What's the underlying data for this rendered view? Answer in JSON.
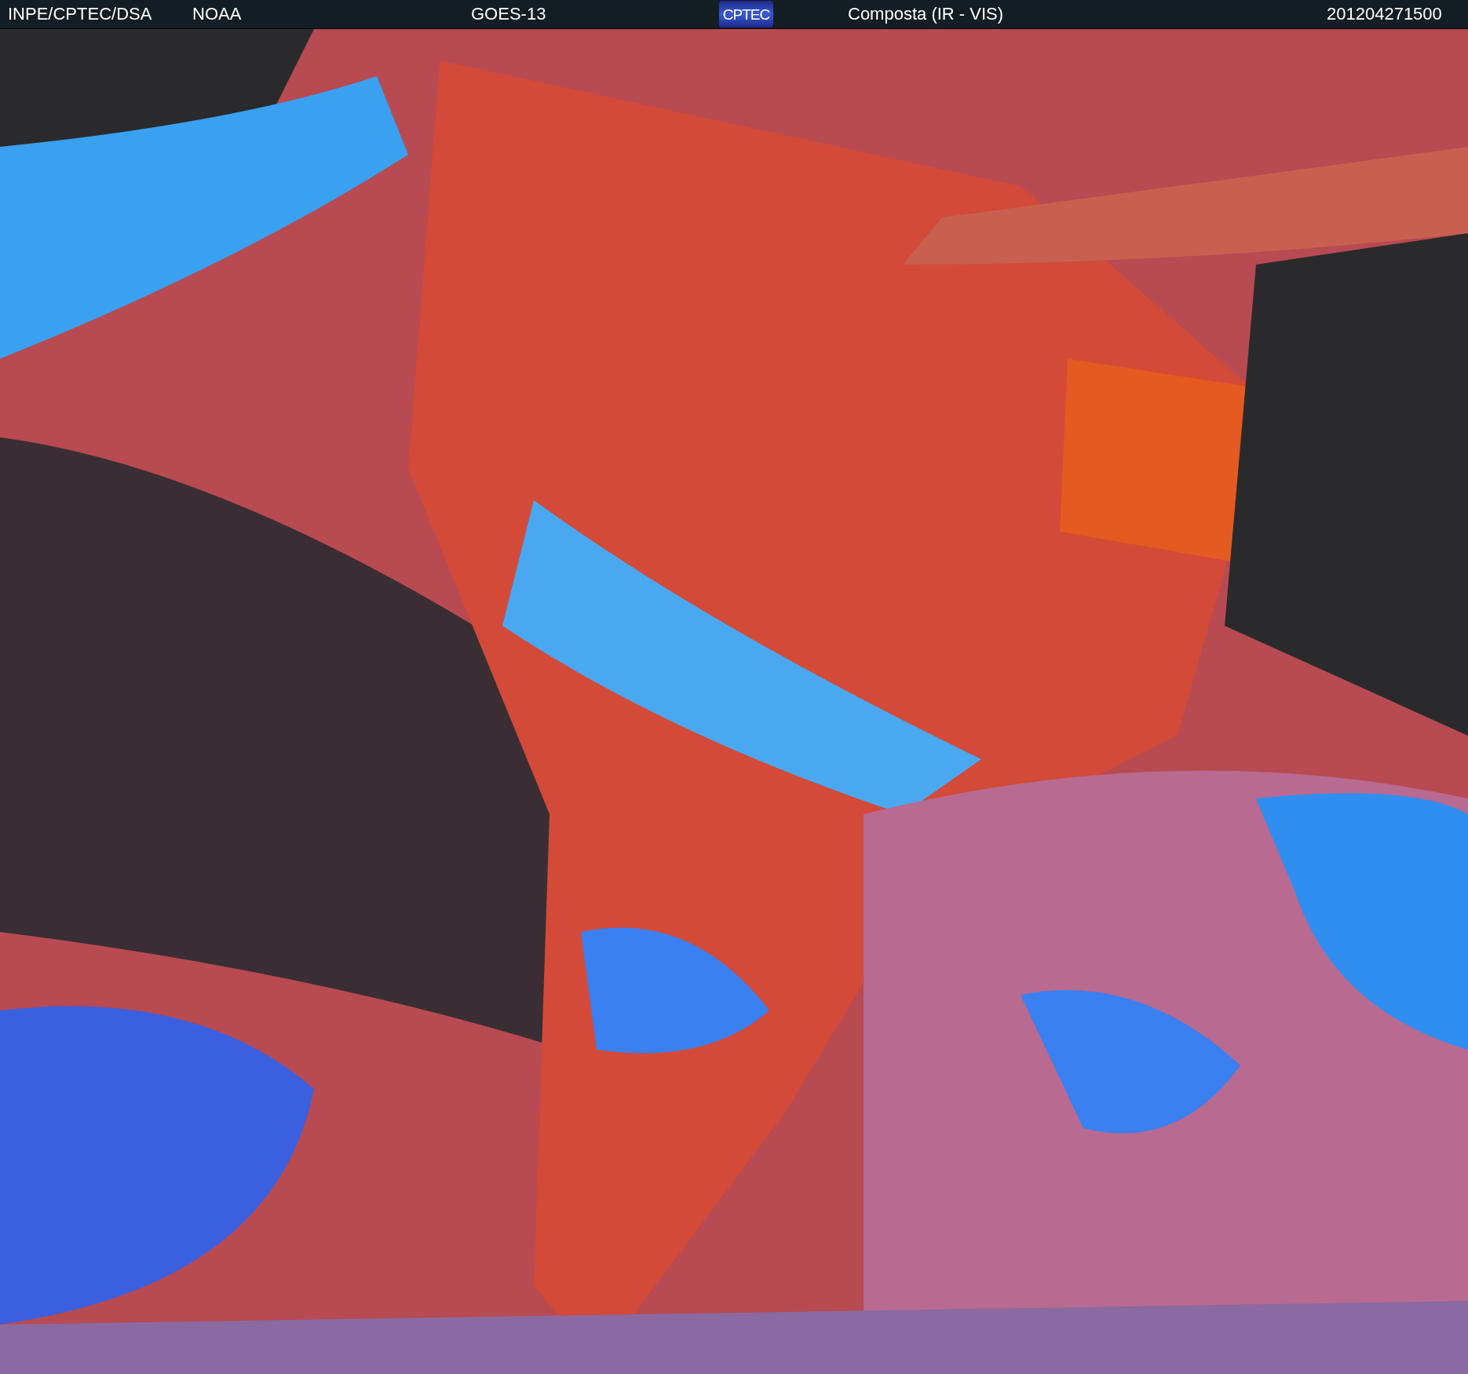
{
  "header": {
    "agency": "INPE/CPTEC/DSA",
    "partner": "NOAA",
    "satellite": "GOES-13",
    "logo_text": "CPTEC",
    "product": "Composta (IR - VIS)",
    "timestamp": "201204271500"
  }
}
